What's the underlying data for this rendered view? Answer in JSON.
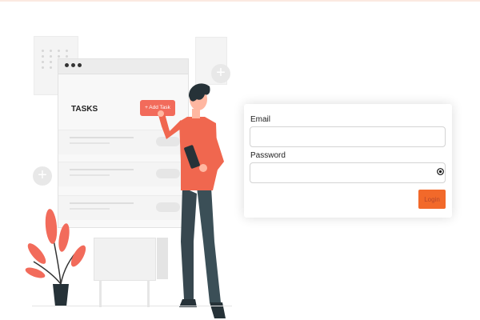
{
  "illustration": {
    "tasks_title": "TASKS",
    "add_task_label": "+ Add Task"
  },
  "login_form": {
    "email_label": "Email",
    "email_value": "",
    "password_label": "Password",
    "password_value": "",
    "toggle_icon": "eye-icon",
    "login_label": "Login"
  },
  "colors": {
    "accent": "#f26b5b",
    "login_button": "#f2692a",
    "shirt": "#f0674f",
    "pants": "#3b4f57"
  }
}
